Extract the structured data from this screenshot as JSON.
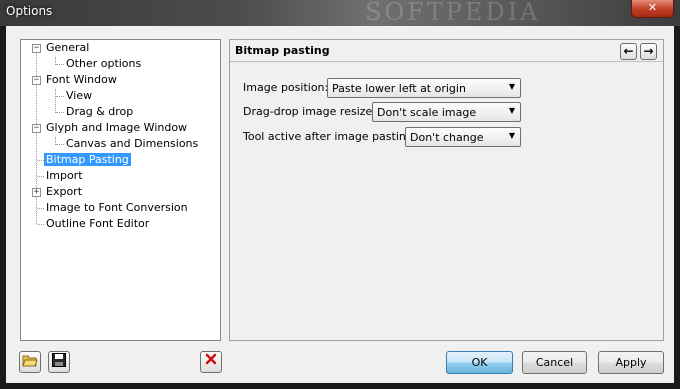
{
  "window": {
    "title": "Options",
    "close_label": "✕",
    "watermark": "SOFTPEDIA"
  },
  "tree": {
    "items": [
      {
        "label": "General"
      },
      {
        "label": "Other options"
      },
      {
        "label": "Font Window"
      },
      {
        "label": "View"
      },
      {
        "label": "Drag & drop"
      },
      {
        "label": "Glyph and Image Window"
      },
      {
        "label": "Canvas and Dimensions"
      },
      {
        "label": "Bitmap Pasting"
      },
      {
        "label": "Import"
      },
      {
        "label": "Export"
      },
      {
        "label": "Image to Font Conversion"
      },
      {
        "label": "Outline Font Editor"
      }
    ],
    "selected": "Bitmap Pasting"
  },
  "panel": {
    "title": "Bitmap pasting",
    "back_icon": "←",
    "forward_icon": "→",
    "fields": [
      {
        "label": "Image position:",
        "value": "Paste lower left at origin"
      },
      {
        "label": "Drag-drop image resize:",
        "value": "Don't scale image"
      },
      {
        "label": "Tool active after image pasting:",
        "value": "Don't change"
      }
    ]
  },
  "footer": {
    "ok_label": "OK",
    "cancel_label": "Cancel",
    "apply_label": "Apply"
  },
  "colors": {
    "selection": "#3399ff",
    "close": "#c13c23",
    "delete_icon": "#d01010"
  }
}
